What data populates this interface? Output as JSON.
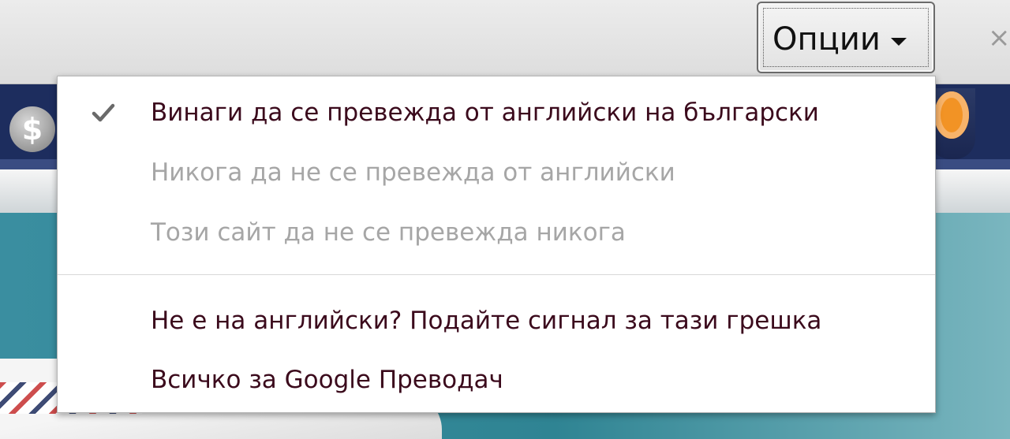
{
  "infobar": {
    "options_label": "Опции",
    "close_glyph": "×"
  },
  "page": {
    "dollar_glyph": "$"
  },
  "menu": {
    "items": [
      {
        "label": "Винаги да се превежда от английски на български",
        "checked": true,
        "enabled": true
      },
      {
        "label": "Никога да не се превежда от английски",
        "checked": false,
        "enabled": false
      },
      {
        "label": "Този сайт да не се превежда никога",
        "checked": false,
        "enabled": false
      },
      {
        "label": "Не е на английски? Подайте сигнал за тази грешка",
        "checked": false,
        "enabled": true
      },
      {
        "label": "Всичко за Google Преводач",
        "checked": false,
        "enabled": true
      }
    ]
  },
  "colors": {
    "enabled_text": "#3b0a1c",
    "disabled_text": "#a6a6a6",
    "page_nav": "#1d2d5e",
    "page_hero": "#2f8493"
  },
  "icons": [
    "check-icon",
    "chevron-down-icon",
    "close-icon",
    "dollar-icon"
  ]
}
